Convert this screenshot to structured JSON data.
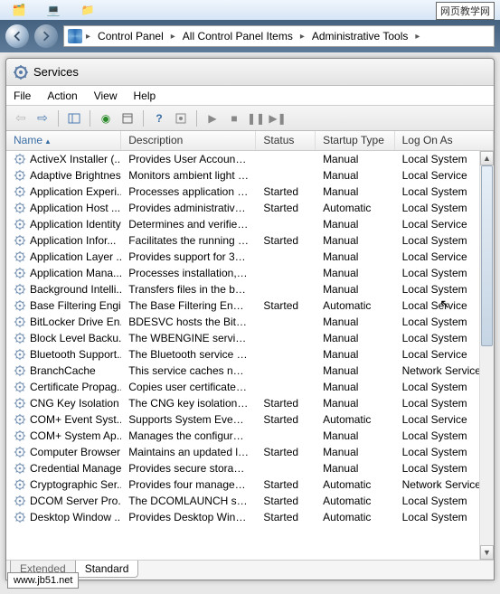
{
  "watermarks": {
    "top_right": "网页教学网",
    "bottom_left": "www.jb51.net"
  },
  "breadcrumb": {
    "segments": [
      "Control Panel",
      "All Control Panel Items",
      "Administrative Tools"
    ]
  },
  "window": {
    "title": "Services"
  },
  "menu": {
    "file": "File",
    "action": "Action",
    "view": "View",
    "help": "Help"
  },
  "columns": {
    "name": "Name",
    "description": "Description",
    "status": "Status",
    "startup": "Startup Type",
    "logon": "Log On As"
  },
  "tabs": {
    "extended": "Extended",
    "standard": "Standard"
  },
  "services": [
    {
      "name": "ActiveX Installer (...",
      "desc": "Provides User Account C...",
      "status": "",
      "startup": "Manual",
      "logon": "Local System"
    },
    {
      "name": "Adaptive Brightness",
      "desc": "Monitors ambient light s...",
      "status": "",
      "startup": "Manual",
      "logon": "Local Service"
    },
    {
      "name": "Application Experi...",
      "desc": "Processes application co...",
      "status": "Started",
      "startup": "Manual",
      "logon": "Local System"
    },
    {
      "name": "Application Host ...",
      "desc": "Provides administrative s...",
      "status": "Started",
      "startup": "Automatic",
      "logon": "Local System"
    },
    {
      "name": "Application Identity",
      "desc": "Determines and verifies t...",
      "status": "",
      "startup": "Manual",
      "logon": "Local Service"
    },
    {
      "name": "Application Infor...",
      "desc": "Facilitates the running of...",
      "status": "Started",
      "startup": "Manual",
      "logon": "Local System"
    },
    {
      "name": "Application Layer ...",
      "desc": "Provides support for 3rd ...",
      "status": "",
      "startup": "Manual",
      "logon": "Local Service"
    },
    {
      "name": "Application Mana...",
      "desc": "Processes installation, re...",
      "status": "",
      "startup": "Manual",
      "logon": "Local System"
    },
    {
      "name": "Background Intelli...",
      "desc": "Transfers files in the bac...",
      "status": "",
      "startup": "Manual",
      "logon": "Local System"
    },
    {
      "name": "Base Filtering Engi...",
      "desc": "The Base Filtering Engine...",
      "status": "Started",
      "startup": "Automatic",
      "logon": "Local Service"
    },
    {
      "name": "BitLocker Drive En...",
      "desc": "BDESVC hosts the BitLoc...",
      "status": "",
      "startup": "Manual",
      "logon": "Local System"
    },
    {
      "name": "Block Level Backu...",
      "desc": "The WBENGINE service is...",
      "status": "",
      "startup": "Manual",
      "logon": "Local System"
    },
    {
      "name": "Bluetooth Support...",
      "desc": "The Bluetooth service su...",
      "status": "",
      "startup": "Manual",
      "logon": "Local Service"
    },
    {
      "name": "BranchCache",
      "desc": "This service caches netw...",
      "status": "",
      "startup": "Manual",
      "logon": "Network Service"
    },
    {
      "name": "Certificate Propag...",
      "desc": "Copies user certificates a...",
      "status": "",
      "startup": "Manual",
      "logon": "Local System"
    },
    {
      "name": "CNG Key Isolation",
      "desc": "The CNG key isolation se...",
      "status": "Started",
      "startup": "Manual",
      "logon": "Local System"
    },
    {
      "name": "COM+ Event Syst...",
      "desc": "Supports System Event N...",
      "status": "Started",
      "startup": "Automatic",
      "logon": "Local Service"
    },
    {
      "name": "COM+ System Ap...",
      "desc": "Manages the configurati...",
      "status": "",
      "startup": "Manual",
      "logon": "Local System"
    },
    {
      "name": "Computer Browser",
      "desc": "Maintains an updated lis...",
      "status": "Started",
      "startup": "Manual",
      "logon": "Local System"
    },
    {
      "name": "Credential Manager",
      "desc": "Provides secure storage ...",
      "status": "",
      "startup": "Manual",
      "logon": "Local System"
    },
    {
      "name": "Cryptographic Ser...",
      "desc": "Provides four managem...",
      "status": "Started",
      "startup": "Automatic",
      "logon": "Network Service"
    },
    {
      "name": "DCOM Server Pro...",
      "desc": "The DCOMLAUNCH serv...",
      "status": "Started",
      "startup": "Automatic",
      "logon": "Local System"
    },
    {
      "name": "Desktop Window ...",
      "desc": "Provides Desktop Windo...",
      "status": "Started",
      "startup": "Automatic",
      "logon": "Local System"
    }
  ]
}
